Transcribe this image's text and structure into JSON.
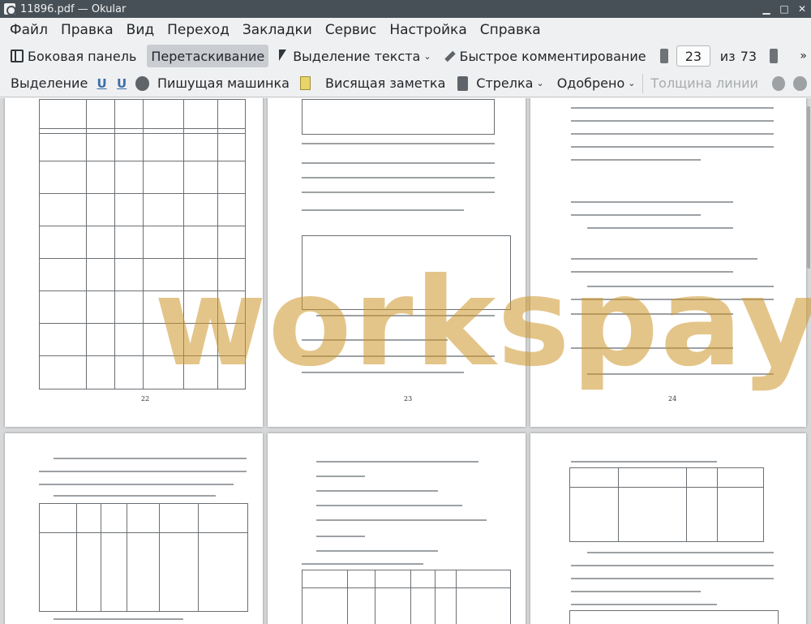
{
  "window": {
    "title": "11896.pdf — Okular"
  },
  "menubar": {
    "items": [
      "Файл",
      "Правка",
      "Вид",
      "Переход",
      "Закладки",
      "Сервис",
      "Настройка",
      "Справка"
    ]
  },
  "toolbar1": {
    "sidebar_label": "Боковая панель",
    "drag_label": "Перетаскивание",
    "text_select_label": "Выделение текста",
    "quick_comment_label": "Быстрое комментирование",
    "current_page": "23",
    "of_label": "из",
    "total_pages": "73"
  },
  "toolbar2": {
    "selection_label": "Выделение",
    "typewriter_label": "Пишущая машинка",
    "popup_note_label": "Висящая заметка",
    "arrow_label": "Стрелка",
    "approved_label": "Одобрено",
    "line_width_label": "Толщина линии"
  },
  "pages": [
    {
      "number": "22"
    },
    {
      "number": "23"
    },
    {
      "number": "24"
    },
    {
      "number": ""
    },
    {
      "number": ""
    },
    {
      "number": ""
    }
  ],
  "watermark": {
    "text": "workspay.ru"
  },
  "icons": {
    "sidebar": "sidebar-panel-icon",
    "drag": "hand-icon",
    "text_select": "cursor-arrow-icon",
    "quick_comment": "pencil-icon",
    "underline": "underline-icon",
    "squiggle": "squiggle-icon",
    "stamp": "stamp-icon",
    "note": "note-icon",
    "arrow_tool": "arrow-tool-icon"
  },
  "colors": {
    "titlebar": "#475057",
    "background": "#eff0f1",
    "active_button": "#c9cdd1",
    "watermark": "#cd9628"
  }
}
